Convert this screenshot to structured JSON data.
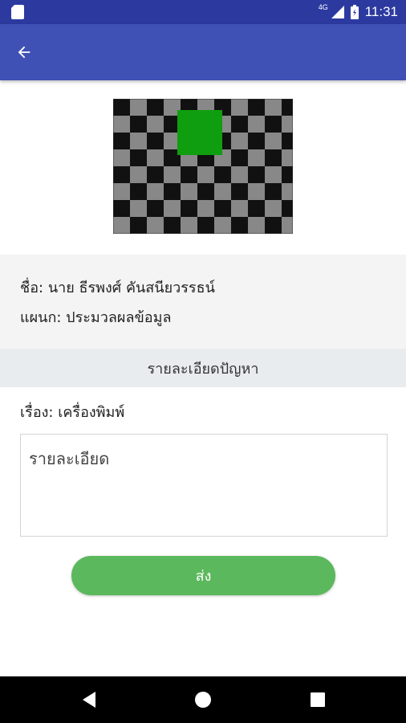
{
  "status_bar": {
    "time": "11:31",
    "network_label": "4G",
    "icons": [
      "sd-card-icon",
      "signal-icon",
      "battery-icon"
    ]
  },
  "app_bar": {
    "back_icon": "arrow-back-icon",
    "color": "#3f51b5"
  },
  "image": {
    "description_icon": "checkerboard-image",
    "accent": "#0f9e0f"
  },
  "user_info": {
    "name_line": "ชื่อ: นาย  ธีรพงศ์  คันสนียวรรธน์",
    "department_line": "แผนก: ประมวลผลข้อมูล"
  },
  "problem_section": {
    "header": "รายละเอียดปัญหา",
    "subject_line": "เรื่อง: เครื่องพิมพ์",
    "detail_placeholder": "รายละเอียด",
    "detail_value": ""
  },
  "actions": {
    "send_label": "ส่ง",
    "send_color": "#5cb85c"
  },
  "nav_bar": {
    "icons": [
      "nav-back-icon",
      "nav-home-icon",
      "nav-recent-icon"
    ]
  }
}
